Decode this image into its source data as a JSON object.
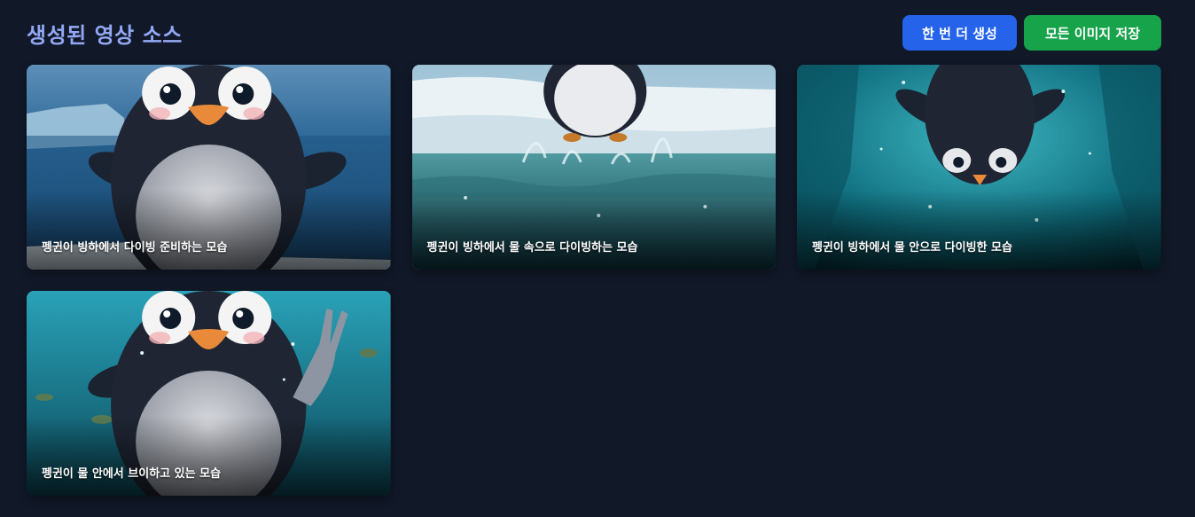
{
  "header": {
    "title": "생성된 영상 소스",
    "regenerate_label": "한 번 더 생성",
    "save_all_label": "모든 이미지 저장"
  },
  "colors": {
    "background": "#111827",
    "title": "#93a8f4",
    "regenerate_button": "#2563eb",
    "save_button": "#16a34a"
  },
  "cards": [
    {
      "caption": "펭귄이 빙하에서 다이빙 준비하는 모습",
      "scene": "standing-on-ice"
    },
    {
      "caption": "펭귄이 빙하에서 물 속으로 다이빙하는 모습",
      "scene": "jumping-into-water"
    },
    {
      "caption": "펭귄이 빙하에서 물 안으로 다이빙한 모습",
      "scene": "diving-underwater"
    },
    {
      "caption": "펭귄이 물 안에서 브이하고 있는 모습",
      "scene": "v-sign-underwater"
    }
  ]
}
